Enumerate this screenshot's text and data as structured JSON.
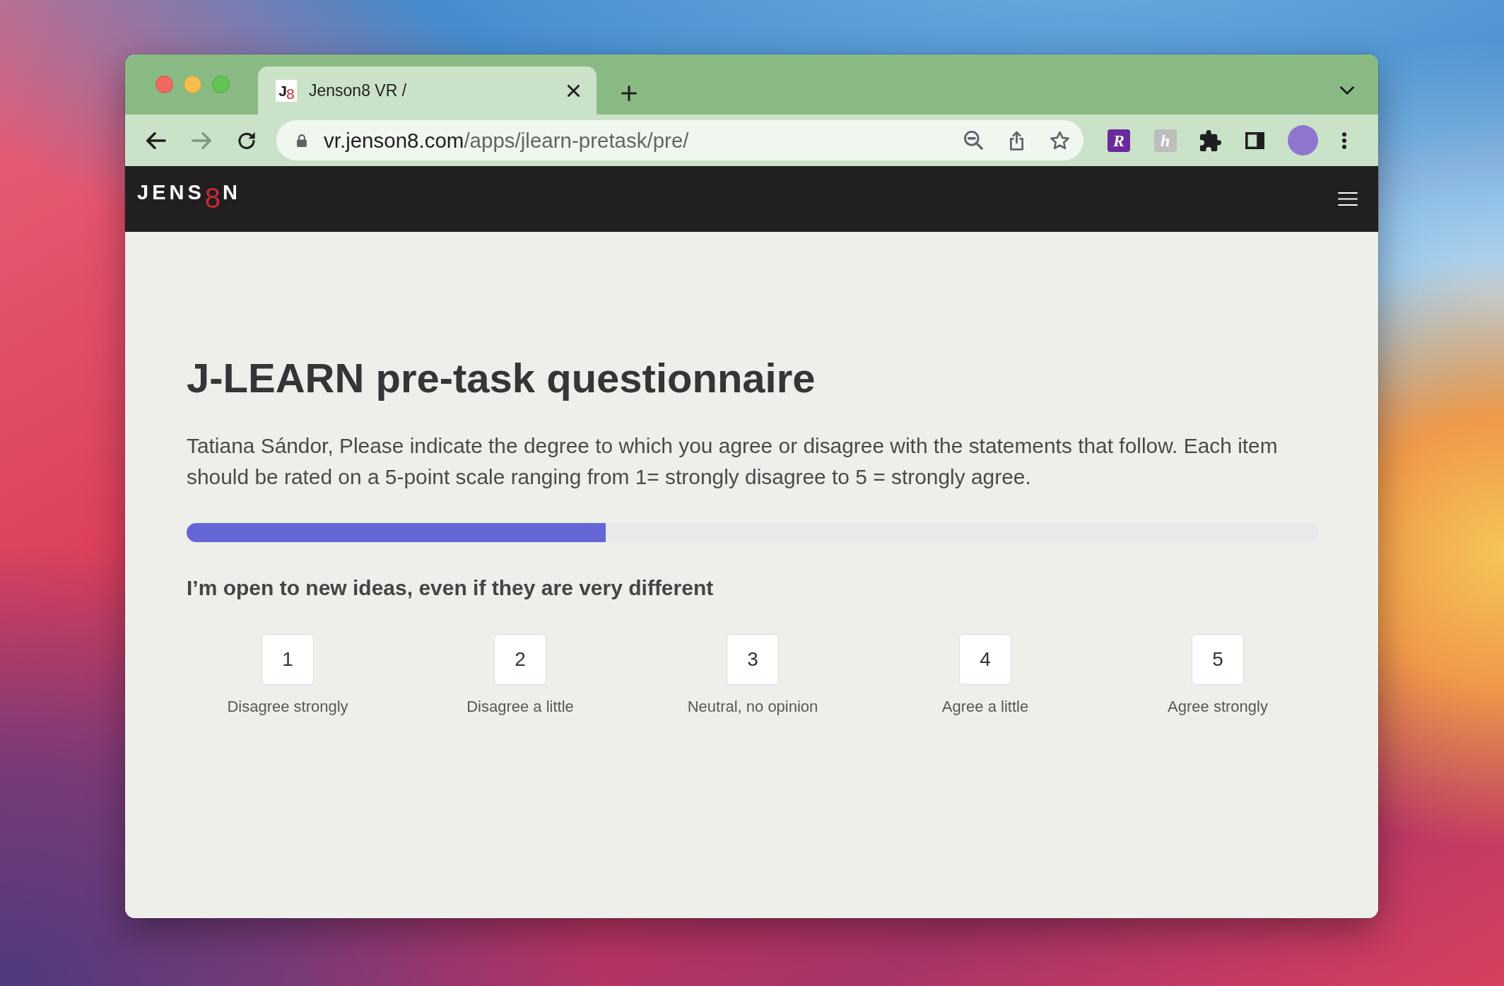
{
  "browser": {
    "tabs": [
      {
        "title": "Jenson8 VR /",
        "selected": true,
        "favicon": [
          {
            "text": "J",
            "accent": false
          },
          {
            "text": "8",
            "accent": true
          }
        ]
      }
    ],
    "nav_buttons": [
      {
        "kind": "back",
        "disabled": false
      },
      {
        "kind": "forward",
        "disabled": true
      },
      {
        "kind": "reload",
        "disabled": false
      }
    ],
    "address": {
      "host": "vr.jenson8.com",
      "path": "/apps/jlearn-pretask/pre/"
    },
    "extensions": [
      {
        "glyph": "R",
        "color": "#6b2a9c"
      },
      {
        "glyph": "h",
        "color": "#bdbdbd"
      }
    ]
  },
  "site_header": {
    "logo": "JENS$_{8}$N"
  },
  "page": {
    "title": "J-LEARN pre-task questionnaire",
    "intro": "Tatiana Sándor, Please indicate the degree to which you agree or disagree with the statements that follow. Each item should be rated on a 5-point scale ranging from 1= strongly disagree to 5 = strongly agree.",
    "progress": {
      "level": 0.37
    },
    "question": "I’m open to new ideas, even if they are very different",
    "options": [
      {
        "value": "1",
        "label": "Disagree strongly",
        "selected": false
      },
      {
        "value": "2",
        "label": "Disagree a little",
        "selected": false
      },
      {
        "value": "3",
        "label": "Neutral, no opinion",
        "selected": false
      },
      {
        "value": "4",
        "label": "Agree a little",
        "selected": false
      },
      {
        "value": "5",
        "label": "Agree strongly",
        "selected": false
      }
    ]
  }
}
